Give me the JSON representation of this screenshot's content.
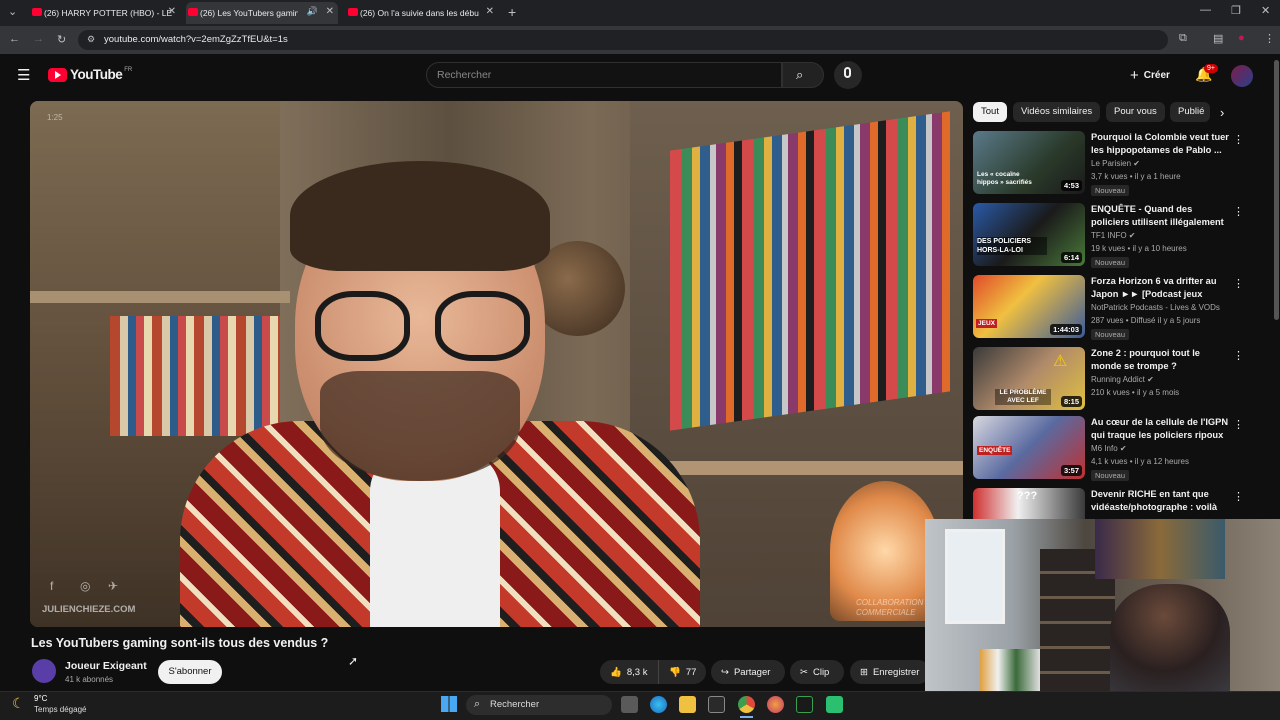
{
  "browser": {
    "tabs": [
      {
        "title": "(26) HARRY POTTER (HBO) - LE",
        "active": false
      },
      {
        "title": "(26) Les YouTubers gaming",
        "active": true
      },
      {
        "title": "(26) On l'a suivie dans les débu",
        "active": false
      }
    ],
    "new_tab": "+",
    "url": "youtube.com/watch?v=2emZgZzTfEU&t=1s"
  },
  "youtube": {
    "logo_text": "YouTube",
    "logo_region": "FR",
    "search_placeholder": "Rechercher",
    "create_label": "Créer",
    "notif_count": "9+"
  },
  "video": {
    "timestamp_overlay": "1:25",
    "watermark": "JULIENCHIEZE.COM",
    "collab_watermark": "COLLABORATION COMMERCIALE",
    "title": "Les YouTubers gaming sont-ils tous des vendus ?",
    "channel": "Joueur Exigeant",
    "subscribers": "41 k abonnés",
    "subscribe_label": "S'abonner",
    "likes": "8,3 k",
    "dislikes": "77",
    "share_label": "Partager",
    "clip_label": "Clip",
    "save_label": "Enregistrer"
  },
  "chips": [
    "Tout",
    "Vidéos similaires",
    "Pour vous",
    "Publié"
  ],
  "recommendations": [
    {
      "title": "Pourquoi la Colombie veut tuer les hippopotames de Pablo ...",
      "channel": "Le Parisien",
      "meta": "3,7 k vues • il y a 1 heure",
      "badge": "Nouveau",
      "duration": "4:53",
      "thumb_text": "Les « cocaïne hippos » sacrifiés"
    },
    {
      "title": "ENQUÊTE - Quand des policiers utilisent illégalement la ...",
      "channel": "TF1 INFO",
      "meta": "19 k vues • il y a 10 heures",
      "badge": "Nouveau",
      "duration": "6:14",
      "thumb_text": "DES POLICIERS HORS-LA-LOI"
    },
    {
      "title": "Forza Horizon 6 va drifter au Japon ►► [Podcast jeux vidéo]",
      "channel": "NotPatrick Podcasts - Lives & VODs",
      "meta": "287 vues • Diffusé il y a 5 jours",
      "badge": "Nouveau",
      "duration": "1:44:03",
      "thumb_text": "JEUX"
    },
    {
      "title": "Zone 2 : pourquoi tout le monde se trompe ?",
      "channel": "Running Addict",
      "meta": "210 k vues • il y a 5 mois",
      "badge": "",
      "duration": "8:15",
      "thumb_text": "LE PROBLÈME AVEC LEF"
    },
    {
      "title": "Au cœur de la cellule de l'IGPN qui traque les policiers ripoux",
      "channel": "M6 Info",
      "meta": "4,1 k vues • il y a 12 heures",
      "badge": "Nouveau",
      "duration": "3:57",
      "thumb_text": "ENQUÊTE"
    },
    {
      "title": "Devenir RICHE en tant que vidéaste/photographe : voilà l...",
      "channel": "",
      "meta": "",
      "badge": "",
      "duration": "",
      "thumb_text": ""
    }
  ],
  "taskbar": {
    "temperature": "9°C",
    "weather": "Temps dégagé",
    "search_label": "Rechercher"
  }
}
